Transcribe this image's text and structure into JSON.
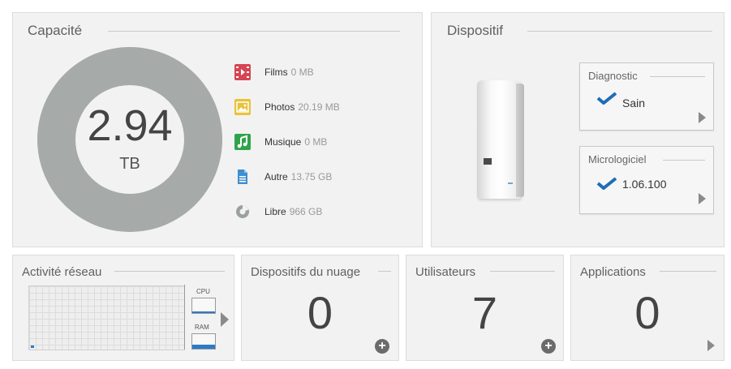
{
  "capacity": {
    "title": "Capacité",
    "total_value": "2.94",
    "total_unit": "TB",
    "legend": [
      {
        "icon": "film-icon",
        "label": "Films",
        "value": "0 MB",
        "color": "#d64553"
      },
      {
        "icon": "photo-icon",
        "label": "Photos",
        "value": "20.19 MB",
        "color": "#e8c23a"
      },
      {
        "icon": "music-icon",
        "label": "Musique",
        "value": "0 MB",
        "color": "#2fa34a"
      },
      {
        "icon": "document-icon",
        "label": "Autre",
        "value": "13.75 GB",
        "color": "#3d8fd0"
      },
      {
        "icon": "free-space-icon",
        "label": "Libre",
        "value": "966 GB",
        "color": "#9aa09e"
      }
    ]
  },
  "device": {
    "title": "Dispositif",
    "diagnostic": {
      "title": "Diagnostic",
      "status": "Sain"
    },
    "firmware": {
      "title": "Micrologiciel",
      "version": "1.06.100"
    }
  },
  "network": {
    "title": "Activité réseau",
    "cpu_label": "CPU",
    "ram_label": "RAM",
    "cpu_level": 0.1,
    "ram_level": 0.3
  },
  "cloud": {
    "title": "Dispositifs du nuage",
    "count": "0"
  },
  "users": {
    "title": "Utilisateurs",
    "count": "7"
  },
  "apps": {
    "title": "Applications",
    "count": "0"
  },
  "colors": {
    "accent": "#2c7bc6",
    "check": "#1e6db5",
    "panel_bg": "#f2f2f2"
  }
}
